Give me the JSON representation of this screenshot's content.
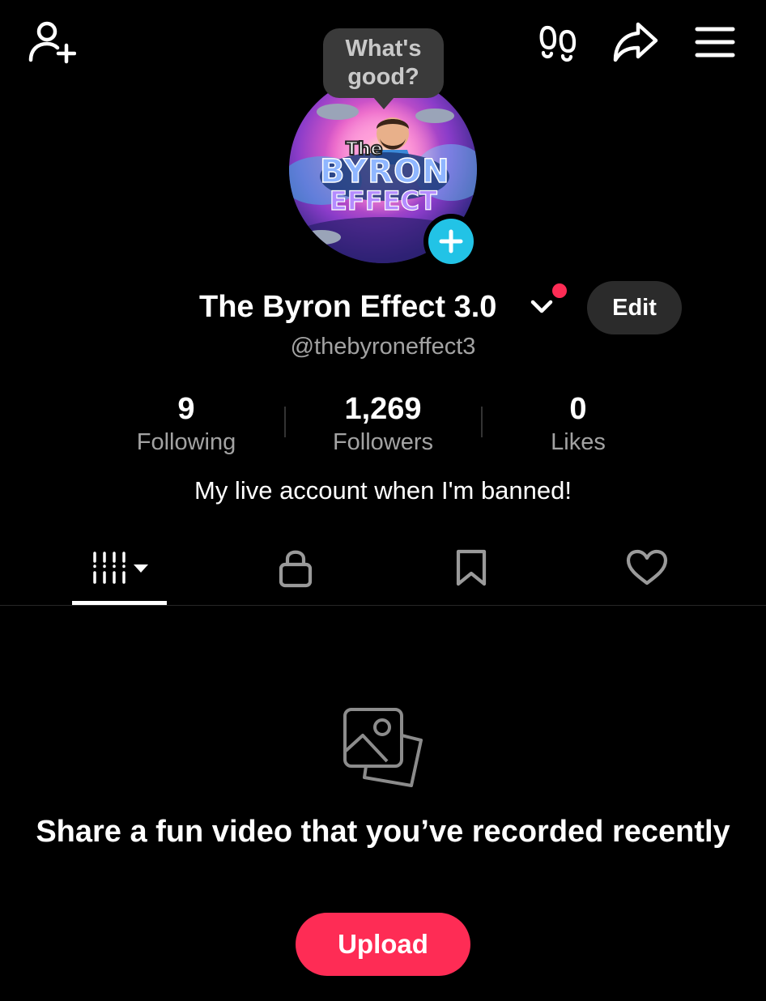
{
  "header": {
    "icons": [
      "add-friend-icon",
      "footprints-icon",
      "share-icon",
      "menu-icon"
    ]
  },
  "bubble": {
    "text": "What's good?"
  },
  "avatar": {
    "badge_icon": "plus-icon",
    "badge_color": "#22c3e6"
  },
  "profile": {
    "display_name": "The Byron Effect 3.0",
    "username": "@thebyroneffect3",
    "edit_label": "Edit",
    "bio": "My live account when I'm banned!"
  },
  "stats": [
    {
      "value": "9",
      "label": "Following"
    },
    {
      "value": "1,269",
      "label": "Followers"
    },
    {
      "value": "0",
      "label": "Likes"
    }
  ],
  "tabs": [
    {
      "icon": "grid-icon",
      "active": true
    },
    {
      "icon": "lock-icon",
      "active": false
    },
    {
      "icon": "bookmark-icon",
      "active": false
    },
    {
      "icon": "heart-icon",
      "active": false
    }
  ],
  "empty_state": {
    "icon": "photos-icon",
    "title": "Share a fun video that you’ve recorded recently",
    "upload_label": "Upload"
  },
  "colors": {
    "background": "#000000",
    "accent": "#fe2c55",
    "badge": "#22c3e6",
    "secondary_text": "#a3a3a3"
  }
}
